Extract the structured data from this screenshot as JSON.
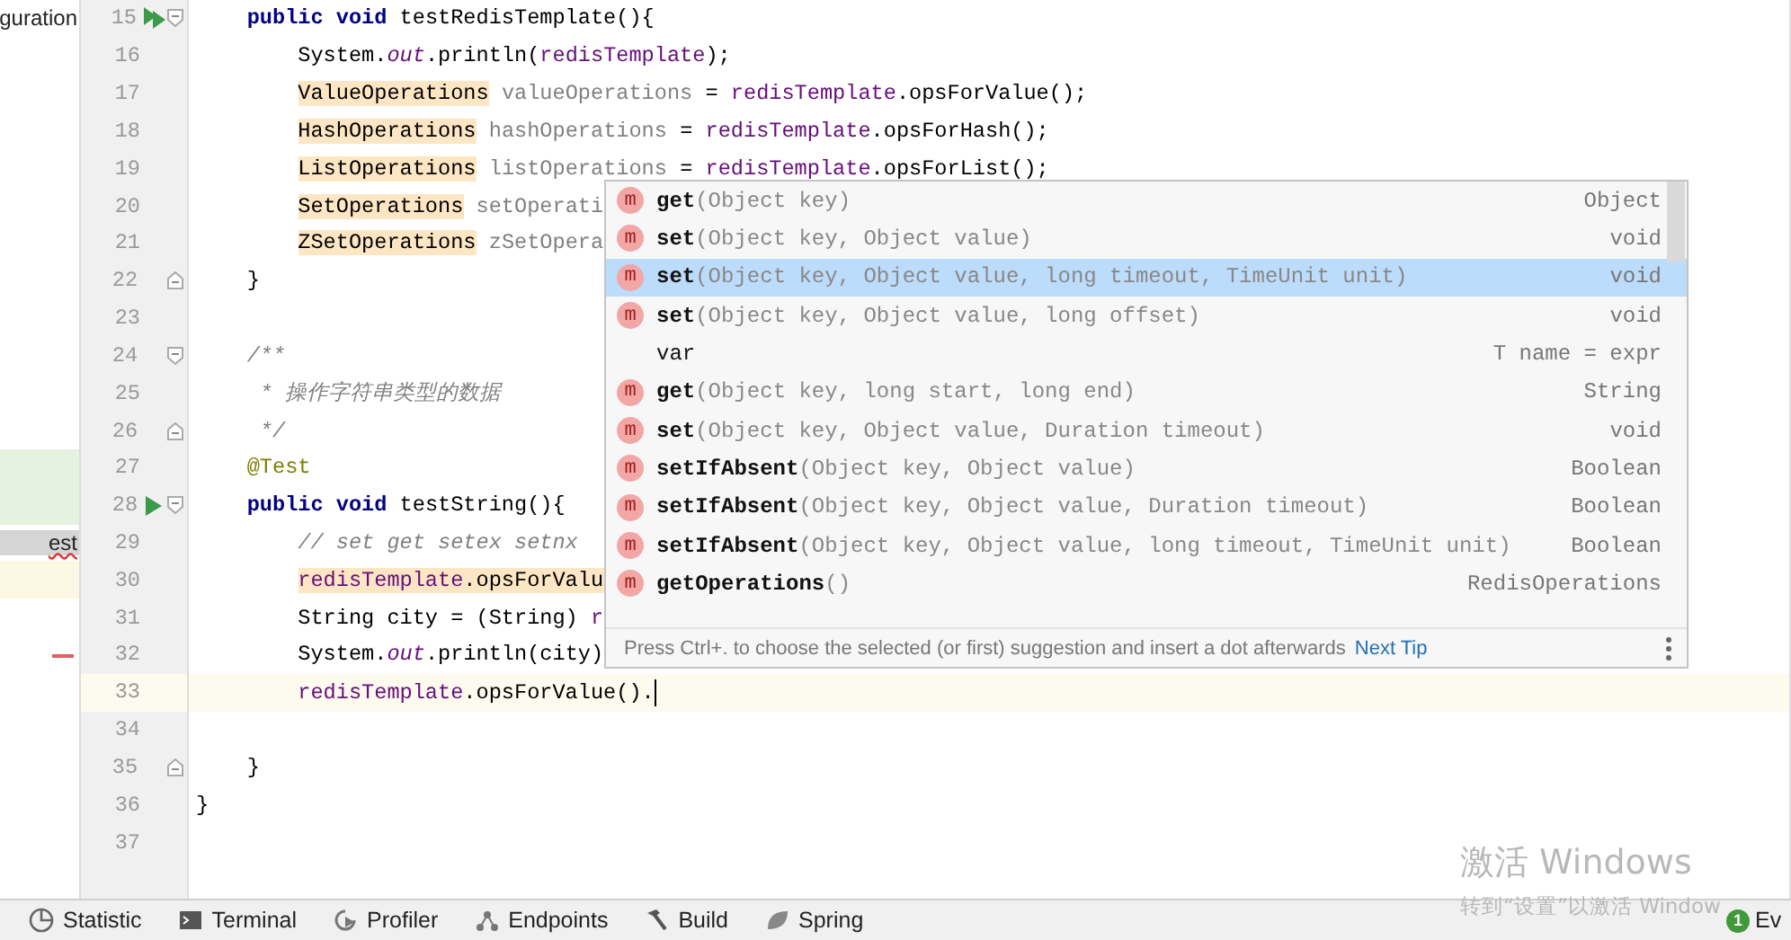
{
  "project_tree": {
    "items": [
      {
        "label": "guration",
        "selected": false,
        "has_error": false
      },
      {
        "label": "est",
        "selected": true,
        "has_error": true
      }
    ]
  },
  "editor": {
    "lines": [
      {
        "number": "15",
        "run_all": true,
        "fold_start": true,
        "tokens": [
          {
            "t": "    public void ",
            "kind": "kw"
          },
          {
            "t": "testRedisTemplate(){",
            "kind": "plain"
          }
        ]
      },
      {
        "number": "16",
        "tokens": [
          {
            "t": "        System.",
            "kind": "plain"
          },
          {
            "t": "out",
            "kind": "static"
          },
          {
            "t": ".println(",
            "kind": "plain"
          },
          {
            "t": "redisTemplate",
            "kind": "field"
          },
          {
            "t": ");",
            "kind": "plain"
          }
        ]
      },
      {
        "number": "17",
        "tokens": [
          {
            "t": "        ValueOperations",
            "kind": "plain",
            "hl": true
          },
          {
            "t": " valueOperations",
            "kind": "unused"
          },
          {
            "t": " = ",
            "kind": "plain"
          },
          {
            "t": "redisTemplate",
            "kind": "field"
          },
          {
            "t": ".opsForValue();",
            "kind": "plain"
          }
        ]
      },
      {
        "number": "18",
        "tokens": [
          {
            "t": "        HashOperations",
            "kind": "plain",
            "hl": true
          },
          {
            "t": " hashOperations",
            "kind": "unused"
          },
          {
            "t": " = ",
            "kind": "plain"
          },
          {
            "t": "redisTemplate",
            "kind": "field"
          },
          {
            "t": ".opsForHash();",
            "kind": "plain"
          }
        ]
      },
      {
        "number": "19",
        "tokens": [
          {
            "t": "        ListOperations",
            "kind": "plain",
            "hl": true
          },
          {
            "t": " listOperations",
            "kind": "unused"
          },
          {
            "t": " = ",
            "kind": "plain"
          },
          {
            "t": "redisTemplate",
            "kind": "field"
          },
          {
            "t": ".opsForList();",
            "kind": "plain"
          }
        ]
      },
      {
        "number": "20",
        "tokens": [
          {
            "t": "        SetOperations",
            "kind": "plain",
            "hl": true
          },
          {
            "t": " setOperati",
            "kind": "unused"
          }
        ]
      },
      {
        "number": "21",
        "tokens": [
          {
            "t": "        ZSetOperations",
            "kind": "plain",
            "hl": true
          },
          {
            "t": " zSetOpera",
            "kind": "unused"
          }
        ]
      },
      {
        "number": "22",
        "fold_end": true,
        "tokens": [
          {
            "t": "    }",
            "kind": "plain"
          }
        ]
      },
      {
        "number": "23"
      },
      {
        "number": "24",
        "fold_start": true,
        "tokens": [
          {
            "t": "    /**",
            "kind": "comment"
          }
        ]
      },
      {
        "number": "25",
        "tokens": [
          {
            "t": "     * 操作字符串类型的数据",
            "kind": "doc"
          }
        ]
      },
      {
        "number": "26",
        "fold_end": true,
        "tokens": [
          {
            "t": "     */",
            "kind": "comment"
          }
        ]
      },
      {
        "number": "27",
        "tokens": [
          {
            "t": "    @Test",
            "kind": "anno"
          }
        ]
      },
      {
        "number": "28",
        "run": true,
        "fold_start": true,
        "tokens": [
          {
            "t": "    public void ",
            "kind": "kw"
          },
          {
            "t": "testString(){",
            "kind": "plain"
          }
        ]
      },
      {
        "number": "29",
        "tokens": [
          {
            "t": "        // set get setex setnx",
            "kind": "doc"
          }
        ]
      },
      {
        "number": "30",
        "tokens": [
          {
            "t": "        redisTemplate",
            "kind": "field",
            "hl": true
          },
          {
            "t": ".opsForValu",
            "kind": "plain",
            "hl": true
          }
        ]
      },
      {
        "number": "31",
        "tokens": [
          {
            "t": "        String city = (String) ",
            "kind": "plain"
          },
          {
            "t": "r",
            "kind": "field"
          }
        ]
      },
      {
        "number": "32",
        "change_mark": true,
        "tokens": [
          {
            "t": "        System.",
            "kind": "plain"
          },
          {
            "t": "out",
            "kind": "static"
          },
          {
            "t": ".println(city)",
            "kind": "plain"
          }
        ]
      },
      {
        "number": "33",
        "current": true,
        "caret": true,
        "tokens": [
          {
            "t": "        redisTemplate",
            "kind": "field"
          },
          {
            "t": ".opsForValue().",
            "kind": "plain"
          }
        ]
      },
      {
        "number": "34"
      },
      {
        "number": "35",
        "fold_end": true,
        "tokens": [
          {
            "t": "    }",
            "kind": "plain"
          }
        ]
      },
      {
        "number": "36",
        "tokens": [
          {
            "t": "}",
            "kind": "plain"
          }
        ]
      },
      {
        "number": "37"
      }
    ]
  },
  "completion_popup": {
    "items": [
      {
        "kind": "method",
        "icon": "m",
        "name": "get",
        "params": "(Object key)",
        "type": "Object",
        "selected": false
      },
      {
        "kind": "method",
        "icon": "m",
        "name": "set",
        "params": "(Object key, Object value)",
        "type": "void",
        "selected": false
      },
      {
        "kind": "method",
        "icon": "m",
        "name": "set",
        "params": "(Object key, Object value, long timeout, TimeUnit unit)",
        "type": "void",
        "selected": true
      },
      {
        "kind": "method",
        "icon": "m",
        "name": "set",
        "params": "(Object key, Object value, long offset)",
        "type": "void",
        "selected": false
      },
      {
        "kind": "template",
        "name": "var",
        "type": "T name = expr",
        "selected": false
      },
      {
        "kind": "method",
        "icon": "m",
        "name": "get",
        "params": "(Object key, long start, long end)",
        "type": "String",
        "selected": false
      },
      {
        "kind": "method",
        "icon": "m",
        "name": "set",
        "params": "(Object key, Object value, Duration timeout)",
        "type": "void",
        "selected": false
      },
      {
        "kind": "method",
        "icon": "m",
        "name": "setIfAbsent",
        "params": "(Object key, Object value)",
        "type": "Boolean",
        "selected": false
      },
      {
        "kind": "method",
        "icon": "m",
        "name": "setIfAbsent",
        "params": "(Object key, Object value, Duration timeout)",
        "type": "Boolean",
        "selected": false
      },
      {
        "kind": "method",
        "icon": "m",
        "name": "setIfAbsent",
        "params": "(Object key, Object value, long timeout, TimeUnit unit)",
        "type": "Boolean",
        "selected": false
      },
      {
        "kind": "method",
        "icon": "m",
        "name": "getOperations",
        "params": "()",
        "type": "RedisOperations",
        "selected": false
      }
    ],
    "hint": "Press Ctrl+. to choose the selected (or first) suggestion and insert a dot afterwards",
    "link": "Next Tip"
  },
  "tool_bar": {
    "items": [
      {
        "kind": "statistic",
        "label": "Statistic"
      },
      {
        "kind": "terminal",
        "label": "Terminal"
      },
      {
        "kind": "profiler",
        "label": "Profiler"
      },
      {
        "kind": "endpoints",
        "label": "Endpoints"
      },
      {
        "kind": "build",
        "label": "Build"
      },
      {
        "kind": "spring",
        "label": "Spring"
      }
    ],
    "event_log": {
      "badge": "1",
      "label": "Ev"
    }
  },
  "activation_notice": {
    "title": "激活 Windows",
    "subtitle": "转到“设置”以激活 Window"
  }
}
